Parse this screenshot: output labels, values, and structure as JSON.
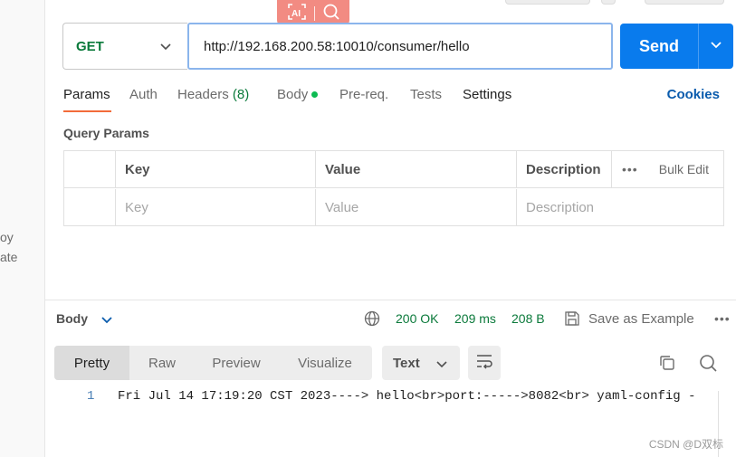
{
  "sidebar": {
    "fragments": [
      "oy",
      "ate"
    ]
  },
  "floating_toolbar": {
    "icons": [
      "ai-text-icon",
      "search-icon"
    ]
  },
  "request": {
    "method": "GET",
    "url": "http://192.168.200.58:10010/consumer/hello",
    "send_label": "Send"
  },
  "tabs": {
    "params": "Params",
    "auth": "Auth",
    "headers": "Headers",
    "headers_count": "(8)",
    "body": "Body",
    "prereq": "Pre-req.",
    "tests": "Tests",
    "settings": "Settings",
    "cookies": "Cookies"
  },
  "query_params": {
    "title": "Query Params",
    "headers": [
      "Key",
      "Value",
      "Description"
    ],
    "bulk_edit": "Bulk Edit",
    "placeholders": [
      "Key",
      "Value",
      "Description"
    ]
  },
  "response": {
    "body_label": "Body",
    "status": "200 OK",
    "time": "209 ms",
    "size": "208 B",
    "save_example": "Save as Example",
    "view_tabs": [
      "Pretty",
      "Raw",
      "Preview",
      "Visualize"
    ],
    "format": "Text",
    "line_number": "1",
    "line_text": "Fri Jul 14 17:19:20 CST 2023----> hello<br>port:----->8082<br> yaml-config -"
  },
  "watermark": "CSDN @D双标",
  "colors": {
    "accent_blue": "#097bed",
    "method_green": "#0b7a3b",
    "tab_underline": "#f26b3a",
    "toolbar_red": "#f28b82"
  }
}
